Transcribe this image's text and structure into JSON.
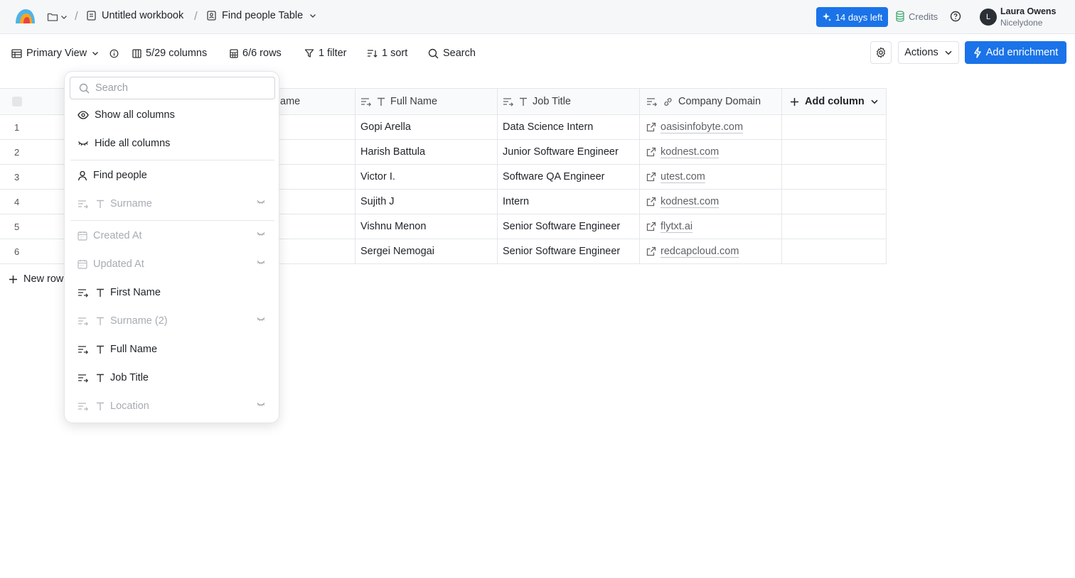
{
  "topbar": {
    "breadcrumb": {
      "workbook": "Untitled workbook",
      "table": "Find people Table",
      "separator": "/"
    },
    "trial_badge": "14 days left",
    "credits": "Credits",
    "user": {
      "name": "Laura Owens",
      "org": "Nicelydone",
      "initial": "L"
    }
  },
  "toolbar": {
    "view": "Primary View",
    "columns": "5/29 columns",
    "rows": "6/6 rows",
    "filter": "1 filter",
    "sort": "1 sort",
    "search": "Search",
    "actions": "Actions",
    "add_enrichment": "Add enrichment"
  },
  "table": {
    "headers": {
      "first": "ame",
      "full": "Full Name",
      "job": "Job Title",
      "domain": "Company Domain",
      "add_column": "Add column"
    },
    "rows": [
      {
        "num": "1",
        "full": "Gopi Arella",
        "job": "Data Science Intern",
        "domain": "oasisinfobyte.com"
      },
      {
        "num": "2",
        "full": "Harish Battula",
        "job": "Junior Software Engineer",
        "domain": "kodnest.com"
      },
      {
        "num": "3",
        "full": "Victor I.",
        "job": "Software QA Engineer",
        "domain": "utest.com"
      },
      {
        "num": "4",
        "full": "Sujith J",
        "job": "Intern",
        "domain": "kodnest.com"
      },
      {
        "num": "5",
        "full": "Vishnu Menon",
        "job": "Senior Software Engineer",
        "domain": "flytxt.ai"
      },
      {
        "num": "6",
        "full": "Sergei Nemogai",
        "job": "Senior Software Engineer",
        "domain": "redcapcloud.com"
      }
    ],
    "new_row": "New row"
  },
  "columns_menu": {
    "search_placeholder": "Search",
    "show_all": "Show all columns",
    "hide_all": "Hide all columns",
    "source": "Find people",
    "items": [
      {
        "label": "Surname",
        "type": "text",
        "visible": false
      },
      {
        "label": "Created At",
        "type": "date",
        "visible": false
      },
      {
        "label": "Updated At",
        "type": "date",
        "visible": false
      },
      {
        "label": "First Name",
        "type": "text",
        "visible": true
      },
      {
        "label": "Surname (2)",
        "type": "text",
        "visible": false
      },
      {
        "label": "Full Name",
        "type": "text",
        "visible": true
      },
      {
        "label": "Job Title",
        "type": "text",
        "visible": true
      },
      {
        "label": "Location",
        "type": "text",
        "visible": false
      }
    ]
  },
  "colors": {
    "accent": "#1a73e8",
    "border": "#e4e6ea",
    "muted_text": "#a7acb2"
  }
}
